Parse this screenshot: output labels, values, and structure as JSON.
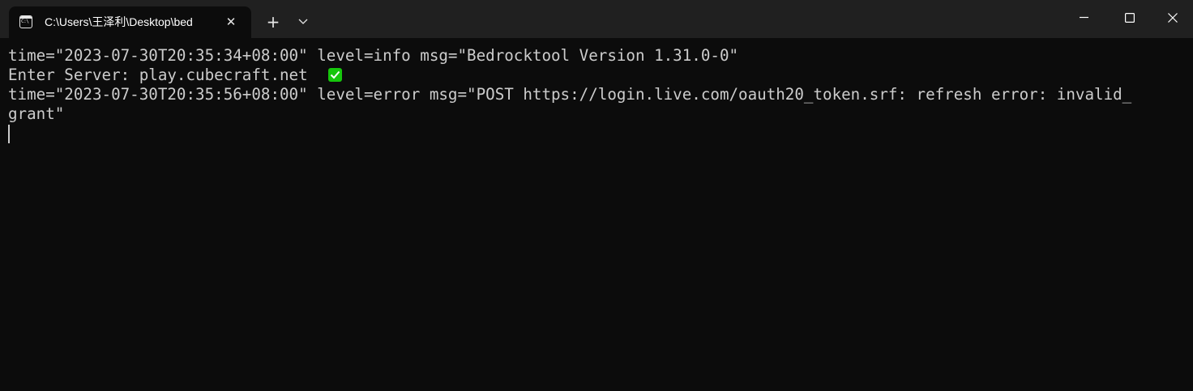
{
  "window": {
    "tab_title": "C:\\Users\\王泽利\\Desktop\\bed",
    "tab_icon": "terminal-icon",
    "close_tab_glyph": "✕",
    "new_tab_glyph": "+",
    "dropdown_icon": "chevron-down-icon",
    "controls": [
      "minimize-icon",
      "maximize-icon",
      "close-icon"
    ]
  },
  "colors": {
    "titlebar": "#202020",
    "background": "#0c0c0c",
    "foreground": "#cccccc",
    "check_green": "#16c60c"
  },
  "terminal": {
    "lines": [
      "time=\"2023-07-30T20:35:34+08:00\" level=info msg=\"Bedrocktool Version 1.31.0-0\"",
      "Enter Server: play.cubecraft.net",
      "time=\"2023-07-30T20:35:56+08:00\" level=error msg=\"POST https://login.live.com/oauth20_token.srf: refresh error: invalid_",
      "grant\""
    ],
    "check_icon": "check-mark-icon"
  }
}
